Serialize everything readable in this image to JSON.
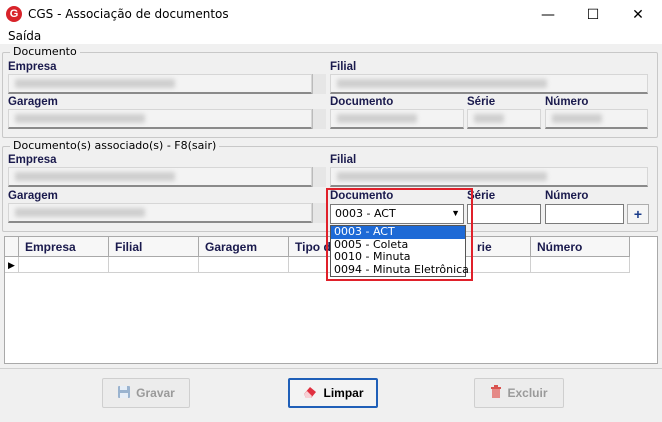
{
  "window": {
    "icon_letter": "G",
    "title": "CGS - Associação de documentos",
    "minimize": "—",
    "maximize": "☐",
    "close": "✕"
  },
  "menu": {
    "saida": "Saída"
  },
  "documento_group": {
    "title": "Documento",
    "empresa_label": "Empresa",
    "filial_label": "Filial",
    "garagem_label": "Garagem",
    "documento_label": "Documento",
    "serie_label": "Série",
    "numero_label": "Número"
  },
  "associados_group": {
    "title": "Documento(s) associado(s) - F8(sair)",
    "empresa_label": "Empresa",
    "filial_label": "Filial",
    "garagem_label": "Garagem",
    "documento_label": "Documento",
    "serie_label": "Série",
    "numero_label": "Número",
    "documento_value": "0003 - ACT",
    "add_button": "+",
    "options": [
      "0003 - ACT",
      "0005 - Coleta",
      "0010 - Minuta",
      "0094 - Minuta Eletrônica"
    ]
  },
  "grid": {
    "columns": [
      "Empresa",
      "Filial",
      "Garagem",
      "Tipo d",
      "rie",
      "Número"
    ],
    "row_indicator": "▶"
  },
  "buttons": {
    "gravar": "Gravar",
    "limpar": "Limpar",
    "excluir": "Excluir"
  },
  "colors": {
    "accent": "#1e6ad6",
    "highlight": "#e0202a",
    "brand": "#d8232a"
  }
}
